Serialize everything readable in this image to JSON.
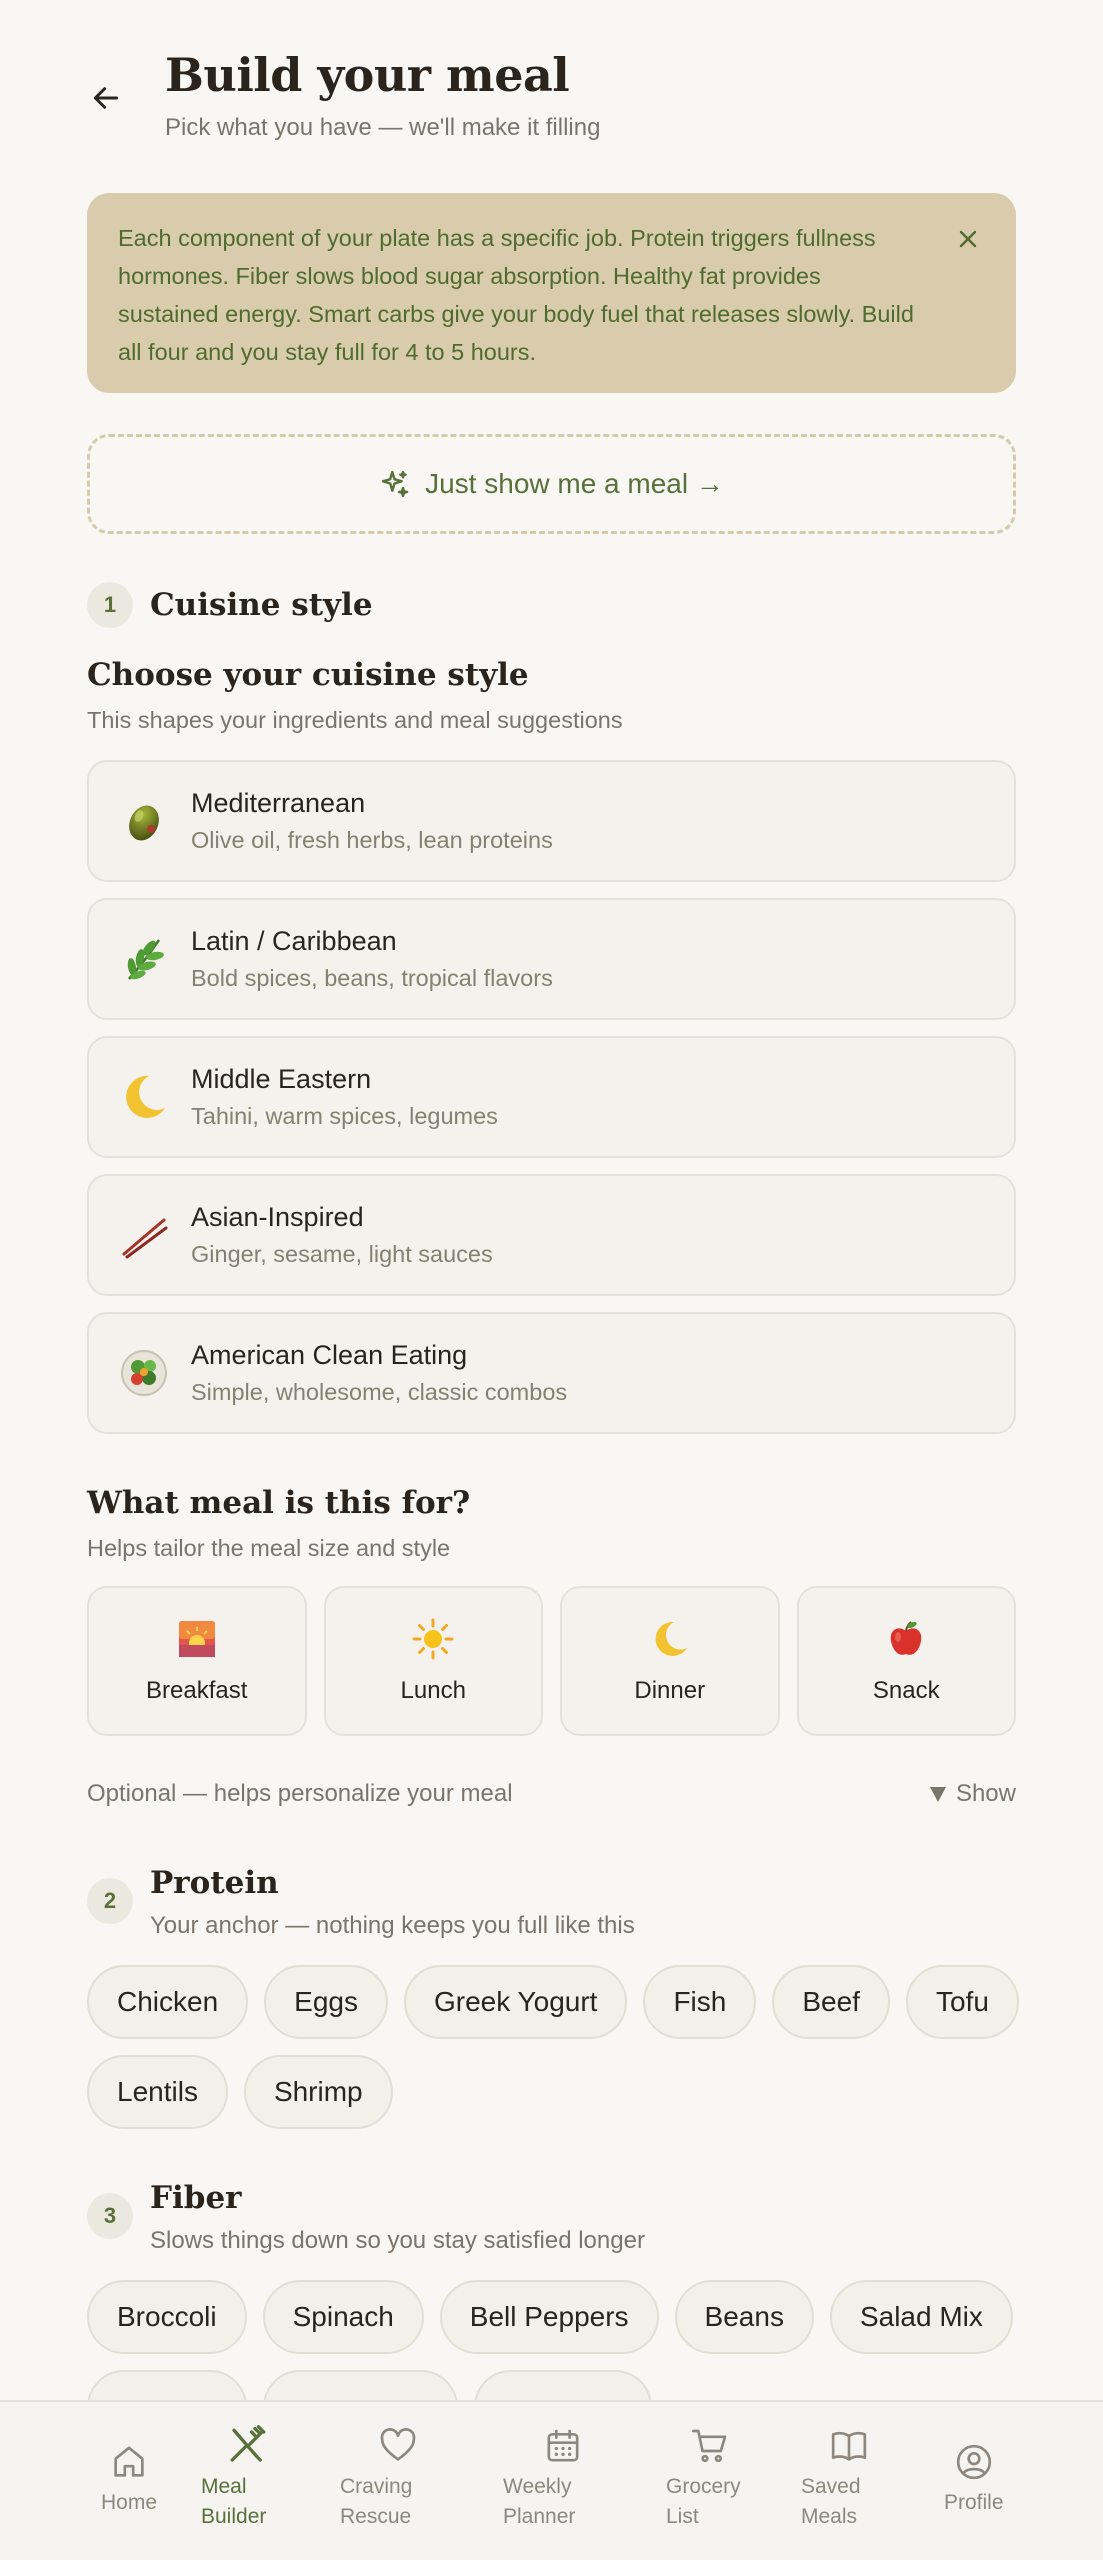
{
  "header": {
    "title": "Build your meal",
    "subtitle": "Pick what you have — we'll make it filling"
  },
  "info_banner": {
    "text": "Each component of your plate has a specific job. Protein triggers fullness hormones. Fiber slows blood sugar absorption. Healthy fat provides sustained energy. Smart carbs give your body fuel that releases slowly. Build all four and you stay full for 4 to 5 hours."
  },
  "quick_action": {
    "label": "Just show me a meal →"
  },
  "step1": {
    "number": "1",
    "title": "Cuisine style"
  },
  "cuisine_section": {
    "title": "Choose your cuisine style",
    "description": "This shapes your ingredients and meal suggestions",
    "options": [
      {
        "name": "Mediterranean",
        "desc": "Olive oil, fresh herbs, lean proteins",
        "icon": "olive-icon"
      },
      {
        "name": "Latin / Caribbean",
        "desc": "Bold spices, beans, tropical flavors",
        "icon": "herb-icon"
      },
      {
        "name": "Middle Eastern",
        "desc": "Tahini, warm spices, legumes",
        "icon": "moon-icon"
      },
      {
        "name": "Asian-Inspired",
        "desc": "Ginger, sesame, light sauces",
        "icon": "chopsticks-icon"
      },
      {
        "name": "American Clean Eating",
        "desc": "Simple, wholesome, classic combos",
        "icon": "salad-icon"
      }
    ]
  },
  "meal_section": {
    "title": "What meal is this for?",
    "description": "Helps tailor the meal size and style",
    "options": [
      {
        "label": "Breakfast",
        "icon": "sunrise-icon"
      },
      {
        "label": "Lunch",
        "icon": "sun-icon"
      },
      {
        "label": "Dinner",
        "icon": "moon-icon"
      },
      {
        "label": "Snack",
        "icon": "apple-icon"
      }
    ],
    "optional_text": "Optional — helps personalize your meal",
    "show_label": "Show"
  },
  "step2": {
    "number": "2",
    "title": "Protein",
    "description": "Your anchor — nothing keeps you full like this",
    "chips": [
      "Chicken",
      "Eggs",
      "Greek Yogurt",
      "Fish",
      "Beef",
      "Tofu",
      "Lentils",
      "Shrimp"
    ]
  },
  "step3": {
    "number": "3",
    "title": "Fiber",
    "description": "Slows things down so you stay satisfied longer",
    "chips": [
      "Broccoli",
      "Spinach",
      "Bell Peppers",
      "Beans",
      "Salad Mix"
    ]
  },
  "bottom_nav": {
    "items": [
      {
        "line1": "Home",
        "line2": "",
        "icon": "home-icon"
      },
      {
        "line1": "Meal",
        "line2": "Builder",
        "icon": "utensils-icon"
      },
      {
        "line1": "Craving",
        "line2": "Rescue",
        "icon": "heart-icon"
      },
      {
        "line1": "Weekly",
        "line2": "Planner",
        "icon": "calendar-icon"
      },
      {
        "line1": "Grocery",
        "line2": "List",
        "icon": "cart-icon"
      },
      {
        "line1": "Saved",
        "line2": "Meals",
        "icon": "book-icon"
      },
      {
        "line1": "Profile",
        "line2": "",
        "icon": "user-icon"
      }
    ],
    "active_index": 1
  },
  "colors": {
    "background": "#f9f7f3",
    "banner": "#d8ccac",
    "accent_green": "#58703a",
    "muted_text": "#7b746b"
  }
}
